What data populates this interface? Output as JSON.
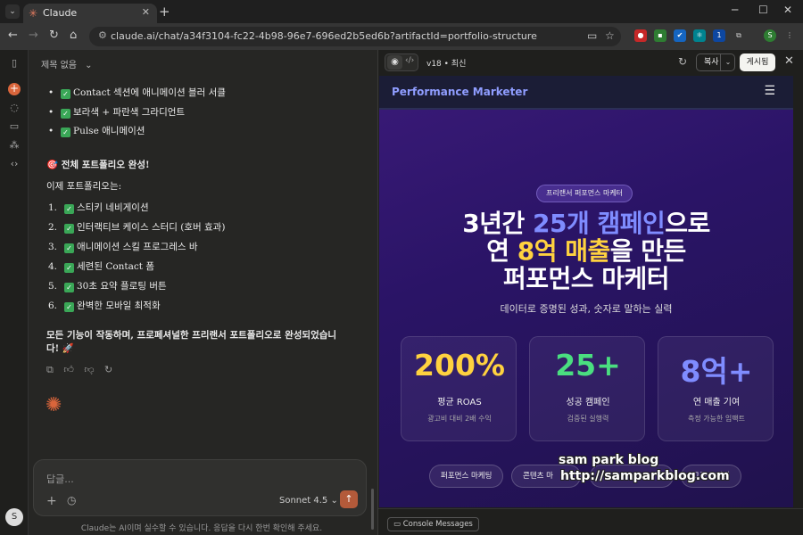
{
  "browser": {
    "tab_title": "Claude",
    "url": "claude.ai/chat/a34f3104-fc22-4b98-96e7-696ed2b5ed6b?artifactId=portfolio-structure"
  },
  "chat": {
    "title": "제목 없음",
    "bullets": [
      "Contact 섹션에 애니메이션 블러 서클",
      "보라색 + 파란색 그라디언트",
      "Pulse 애니메이션"
    ],
    "complete_heading": "🎯 전체 포트폴리오 완성!",
    "now_label": "이제 포트폴리오는:",
    "numbered": [
      {
        "n": "1.",
        "text": "스티키 네비게이션"
      },
      {
        "n": "2.",
        "text": "인터랙티브 케이스 스터디 (호버 효과)"
      },
      {
        "n": "3.",
        "text": "애니메이션 스킬 프로그레스 바"
      },
      {
        "n": "4.",
        "text": "세련된 Contact 폼"
      },
      {
        "n": "5.",
        "text": "30초 요약 플로팅 버튼"
      },
      {
        "n": "6.",
        "text": "완벽한 모바일 최적화"
      }
    ],
    "closing_line1": "모든 기능이 작동하며, 프로페셔널한 프리랜서 포트폴리오로 완성되었습니",
    "closing_line2": "다! 🚀",
    "input_placeholder": "답글...",
    "model": "Sonnet 4.5",
    "disclaimer": "Claude는 AI이며 실수할 수 있습니다. 응답을 다시 한번 확인해 주세요.",
    "avatar_initial": "S"
  },
  "artifact": {
    "version": "v18 • 최신",
    "copy_label": "복사",
    "publish_label": "게시됨",
    "console_label": "Console Messages"
  },
  "site": {
    "brand": "Performance Marketer",
    "badge": "프리랜서 퍼포먼스 마케터",
    "headline": {
      "l1_pre": "3년간 ",
      "l1_hl": "25개 캠페인",
      "l1_post": "으로",
      "l2_pre": "연 ",
      "l2_hl": "8억 매출",
      "l2_post": "을 만든",
      "l3": "퍼포먼스 마케터"
    },
    "subtitle": "데이터로 증명된 성과, 숫자로 말하는 실력",
    "stats": [
      {
        "value": "200%",
        "label": "평균 ROAS",
        "sub": "광고비 대비 2배 수익",
        "color": "#ffd23f"
      },
      {
        "value": "25+",
        "label": "성공 캠페인",
        "sub": "검증된 실행력",
        "color": "#4ade80"
      },
      {
        "value": "8억+",
        "label": "연 매출 기여",
        "sub": "측정 가능한 임팩트",
        "color": "#7f8cff"
      }
    ],
    "chips": [
      "퍼포먼스 마케팅",
      "콘텐츠 마",
      "그로스 해킹"
    ]
  },
  "watermark": {
    "line1": "sam park blog",
    "line2": "http://samparkblog.com"
  },
  "colors": {
    "accent": "#d9653b",
    "site_bg": "#2a1466",
    "brand_blue": "#7f8cff",
    "highlight_yellow": "#ffd23f"
  }
}
